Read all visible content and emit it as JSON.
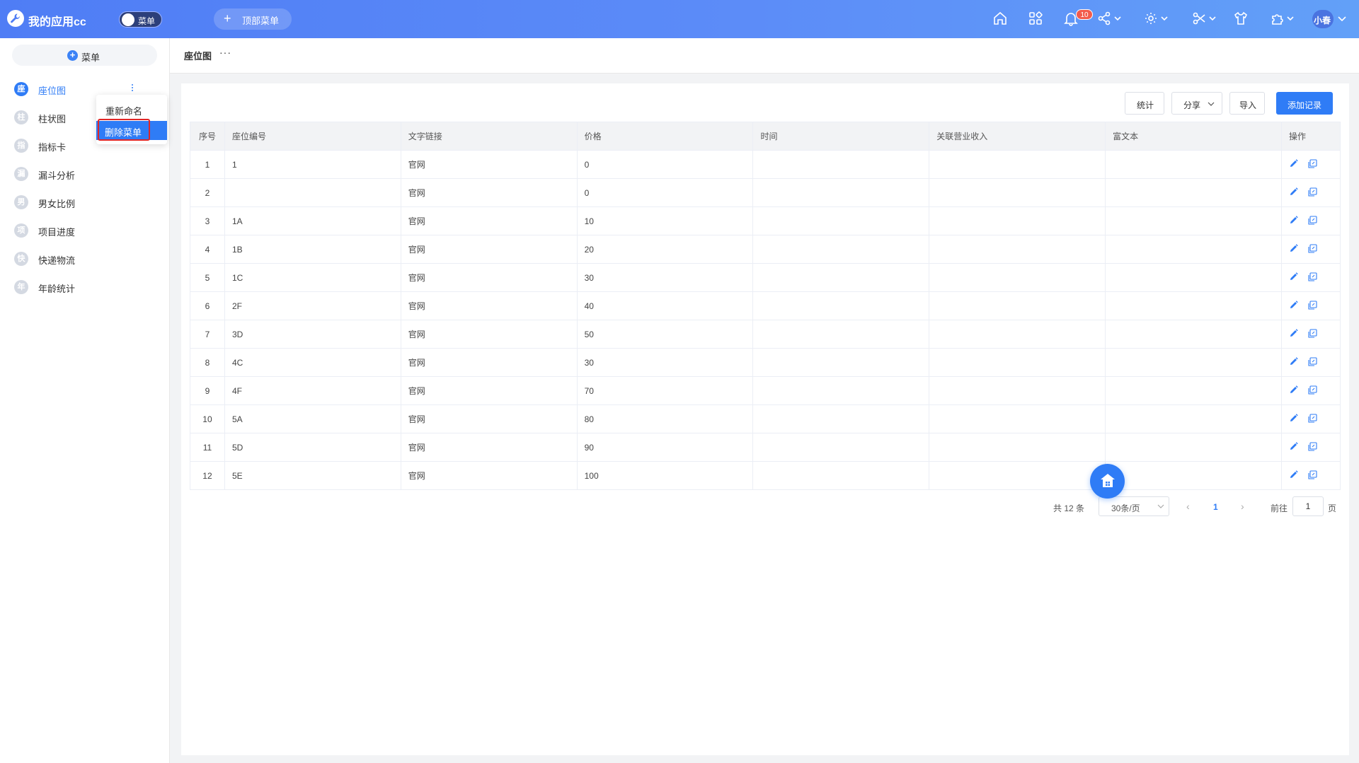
{
  "app": {
    "title": "我的应用cc",
    "toggle_label": "菜单",
    "top_menu_label": "顶部菜单",
    "notification_count": "10",
    "user_name": "小春"
  },
  "sidebar": {
    "add_label": "菜单",
    "items": [
      {
        "icon_char": "座",
        "label": "座位图",
        "active": true
      },
      {
        "icon_char": "柱",
        "label": "柱状图"
      },
      {
        "icon_char": "指",
        "label": "指标卡"
      },
      {
        "icon_char": "漏",
        "label": "漏斗分析"
      },
      {
        "icon_char": "男",
        "label": "男女比例"
      },
      {
        "icon_char": "项",
        "label": "项目进度"
      },
      {
        "icon_char": "快",
        "label": "快递物流"
      },
      {
        "icon_char": "年",
        "label": "年龄统计"
      }
    ]
  },
  "context_menu": {
    "rename_label": "重新命名",
    "delete_label": "删除菜单"
  },
  "breadcrumb": {
    "title": "座位图",
    "more": "···"
  },
  "toolbar": {
    "stats_label": "统计",
    "share_label": "分享",
    "import_label": "导入",
    "add_record_label": "添加记录"
  },
  "table": {
    "columns": [
      "序号",
      "座位编号",
      "文字链接",
      "价格",
      "时间",
      "关联营业收入",
      "富文本",
      "操作"
    ],
    "rows": [
      {
        "idx": "1",
        "seat": "1",
        "link": "官网",
        "price": "0",
        "time": "",
        "revenue": "",
        "rich": ""
      },
      {
        "idx": "2",
        "seat": "",
        "link": "官网",
        "price": "0",
        "time": "",
        "revenue": "",
        "rich": ""
      },
      {
        "idx": "3",
        "seat": "1A",
        "link": "官网",
        "price": "10",
        "time": "",
        "revenue": "",
        "rich": ""
      },
      {
        "idx": "4",
        "seat": "1B",
        "link": "官网",
        "price": "20",
        "time": "",
        "revenue": "",
        "rich": ""
      },
      {
        "idx": "5",
        "seat": "1C",
        "link": "官网",
        "price": "30",
        "time": "",
        "revenue": "",
        "rich": ""
      },
      {
        "idx": "6",
        "seat": "2F",
        "link": "官网",
        "price": "40",
        "time": "",
        "revenue": "",
        "rich": ""
      },
      {
        "idx": "7",
        "seat": "3D",
        "link": "官网",
        "price": "50",
        "time": "",
        "revenue": "",
        "rich": ""
      },
      {
        "idx": "8",
        "seat": "4C",
        "link": "官网",
        "price": "30",
        "time": "",
        "revenue": "",
        "rich": ""
      },
      {
        "idx": "9",
        "seat": "4F",
        "link": "官网",
        "price": "70",
        "time": "",
        "revenue": "",
        "rich": ""
      },
      {
        "idx": "10",
        "seat": "5A",
        "link": "官网",
        "price": "80",
        "time": "",
        "revenue": "",
        "rich": ""
      },
      {
        "idx": "11",
        "seat": "5D",
        "link": "官网",
        "price": "90",
        "time": "",
        "revenue": "",
        "rich": ""
      },
      {
        "idx": "12",
        "seat": "5E",
        "link": "官网",
        "price": "100",
        "time": "",
        "revenue": "",
        "rich": ""
      }
    ]
  },
  "pagination": {
    "total_label": "共 12 条",
    "page_size": "30条/页",
    "current_page": "1",
    "goto_label": "前往",
    "goto_value": "1",
    "page_suffix": "页"
  },
  "colors": {
    "accent": "#2f7cf6",
    "header_gradient_start": "#4f7df5",
    "header_gradient_end": "#62a0f8",
    "badge": "#f25b4c",
    "highlight_border": "#e02626"
  }
}
